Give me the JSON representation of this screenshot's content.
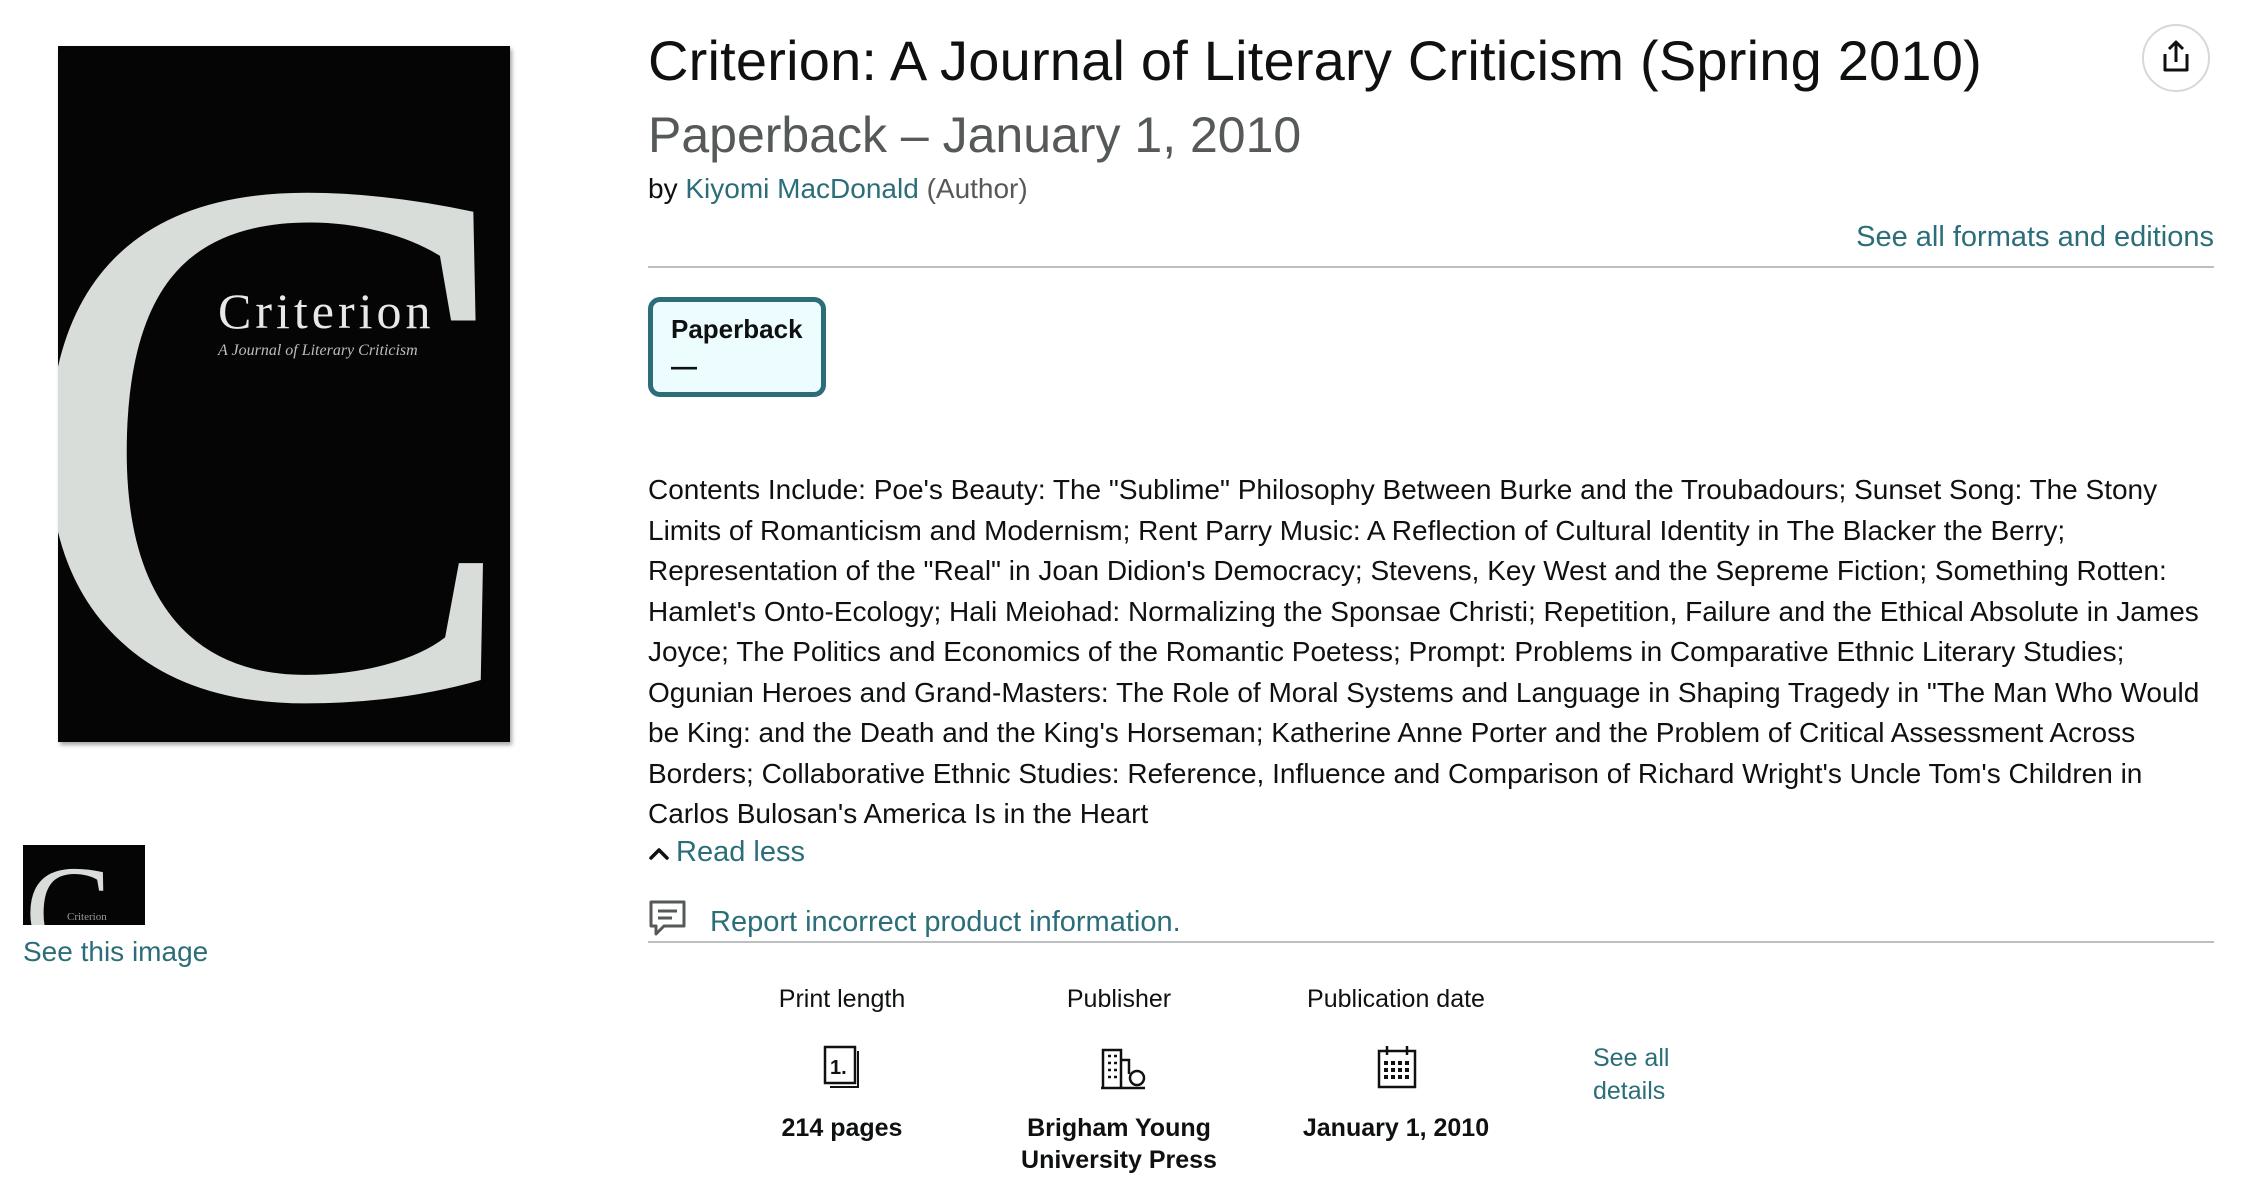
{
  "product": {
    "title": "Criterion: A Journal of Literary Criticism (Spring 2010)",
    "subtitle": "Paperback – January 1, 2010",
    "by_prefix": "by",
    "author": "Kiyomi MacDonald",
    "author_role": "(Author)",
    "formats_link": "See all formats and editions"
  },
  "format": {
    "label": "Paperback",
    "price": "—"
  },
  "cover": {
    "big_letter": "C",
    "title": "Criterion",
    "subtitle": "A Journal of Literary Criticism",
    "thumb_label": "Criterion",
    "see_image": "See this image"
  },
  "description": {
    "text": "Contents Include: Poe's Beauty: The \"Sublime\" Philosophy Between Burke and the Troubadours; Sunset Song: The Stony Limits of Romanticism and Modernism; Rent Parry Music: A Reflection of Cultural Identity in The Blacker the Berry; Representation of the \"Real\" in Joan Didion's Democracy; Stevens, Key West and the Sepreme Fiction; Something Rotten: Hamlet's Onto-Ecology; Hali Meiohad: Normalizing the Sponsae Christi; Repetition, Failure and the Ethical Absolute in James Joyce; The Politics and Economics of the Romantic Poetess; Prompt: Problems in Comparative Ethnic Literary Studies; Ogunian Heroes and Grand-Masters: The Role of Moral Systems and Language in Shaping Tragedy in \"The Man Who Would be King: and the Death and the King's Horseman; Katherine Anne Porter and the Problem of Critical Assessment Across Borders; Collaborative Ethnic Studies: Reference, Influence and Comparison of Richard Wright's Uncle Tom's Children in Carlos Bulosan's America Is in the Heart",
    "read_less": "Read less"
  },
  "report": {
    "label": "Report incorrect product information."
  },
  "details": {
    "print_length": {
      "label": "Print length",
      "value": "214 pages",
      "icon": "book-pages-icon"
    },
    "publisher": {
      "label": "Publisher",
      "value_line1": "Brigham Young",
      "value_line2": "University Press",
      "icon": "building-icon"
    },
    "publication_date": {
      "label": "Publication date",
      "value": "January 1, 2010",
      "icon": "calendar-icon"
    },
    "see_all_line1": "See all",
    "see_all_line2": "details"
  },
  "colors": {
    "link": "#2b6e7a",
    "format_border": "#2b6e7a",
    "format_bg": "#edfdff",
    "text": "#0f1111",
    "muted": "#565959"
  }
}
